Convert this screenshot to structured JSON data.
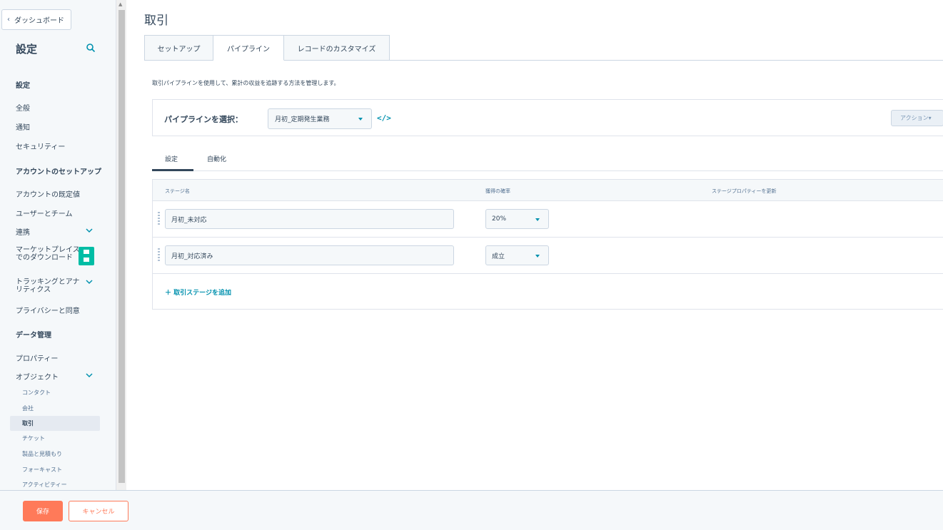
{
  "colors": {
    "accent": "#0091ae",
    "primary_button": "#ff7a59",
    "badge": "#00bda5",
    "text": "#33475b",
    "border": "#cbd6e2"
  },
  "sidebar": {
    "back_label": "ダッシュボード",
    "title": "設定",
    "search_icon": "search-icon",
    "sections": {
      "settings_head": "設定",
      "general": "全般",
      "notifications": "通知",
      "security": "セキュリティー",
      "account_setup_head": "アカウントのセットアップ",
      "account_defaults": "アカウントの既定値",
      "users_teams": "ユーザーとチーム",
      "integrations": "連携",
      "marketplace_line1": "マーケットプレイス",
      "marketplace_line2": "でのダウンロード",
      "tracking_line1": "トラッキングとアナ",
      "tracking_line2": "リティクス",
      "privacy": "プライバシーと同意",
      "data_mgmt_head": "データ管理",
      "properties": "プロパティー",
      "objects": "オブジェクト"
    },
    "object_items": [
      "コンタクト",
      "会社",
      "取引",
      "チケット",
      "製品と見積もり",
      "フォーキャスト",
      "アクティビティー"
    ],
    "active_object": "取引"
  },
  "main": {
    "page_title": "取引",
    "tabs": [
      "セットアップ",
      "パイプライン",
      "レコードのカスタマイズ"
    ],
    "active_tab": "パイプライン",
    "description": "取引パイプラインを使用して、累計の収益を追跡する方法を管理します。",
    "pipeline": {
      "label": "パイプラインを選択：",
      "selected": "月初_定期発生業務",
      "code_icon": "</>",
      "action_label": "アクション▾"
    },
    "subtabs": [
      "設定",
      "自動化"
    ],
    "active_subtab": "設定",
    "table": {
      "headers": [
        "ステージ名",
        "獲得の確率",
        "ステージプロパティーを更新"
      ],
      "rows": [
        {
          "stage": "月初_未対応",
          "probability": "20%"
        },
        {
          "stage": "月初_対応済み",
          "probability": "成立"
        }
      ],
      "add_stage": "＋ 取引ステージを追加"
    }
  },
  "footer": {
    "save": "保存",
    "cancel": "キャンセル"
  }
}
